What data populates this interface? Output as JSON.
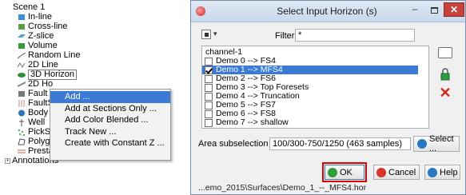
{
  "tree": {
    "items": [
      {
        "label": "Scene 1"
      },
      {
        "label": "In-line"
      },
      {
        "label": "Cross-line"
      },
      {
        "label": "Z-slice"
      },
      {
        "label": "Volume"
      },
      {
        "label": "Random Line"
      },
      {
        "label": "2D Line"
      },
      {
        "label": "3D Horizon"
      },
      {
        "label": "2D Ho"
      },
      {
        "label": "Fault"
      },
      {
        "label": "FaultS"
      },
      {
        "label": "Body"
      },
      {
        "label": "Well"
      },
      {
        "label": "PickS"
      },
      {
        "label": "Polygon"
      },
      {
        "label": "Prestack Events"
      },
      {
        "label": "Annotations"
      }
    ]
  },
  "context_menu": {
    "items": [
      {
        "label": "Add ..."
      },
      {
        "label": "Add at Sections Only ..."
      },
      {
        "label": "Add Color Blended ..."
      },
      {
        "label": "Track New ..."
      },
      {
        "label": "Create with Constant Z ..."
      }
    ]
  },
  "dialog": {
    "title": "Select Input Horizon (s)",
    "filter_label": "Filter",
    "filter_value": "*",
    "list_items": [
      {
        "label": "channel-1",
        "checked": false
      },
      {
        "label": "Demo 0 --> FS4",
        "checked": false
      },
      {
        "label": "Demo 1 --> MFS4",
        "checked": true
      },
      {
        "label": "Demo 2 --> FS6",
        "checked": false
      },
      {
        "label": "Demo 3  --> Top Foresets",
        "checked": false
      },
      {
        "label": "Demo 4 --> Truncation",
        "checked": false
      },
      {
        "label": "Demo 5 --> FS7",
        "checked": false
      },
      {
        "label": "Demo 6 --> FS8",
        "checked": false
      },
      {
        "label": "Demo 7 --> shallow",
        "checked": false
      }
    ],
    "area_label": "Area subselection",
    "area_value": "100/300-750/1250 (463 samples)",
    "select_button": "Select ...",
    "ok_button": "OK",
    "cancel_button": "Cancel",
    "help_button": "Help",
    "status_path": "...emo_2015\\Surfaces\\Demo_1_--_MFS4.hor"
  },
  "colors": {
    "selection": "#3b7bd6",
    "ok_highlight": "#e00000",
    "close_button": "#c7423a"
  }
}
